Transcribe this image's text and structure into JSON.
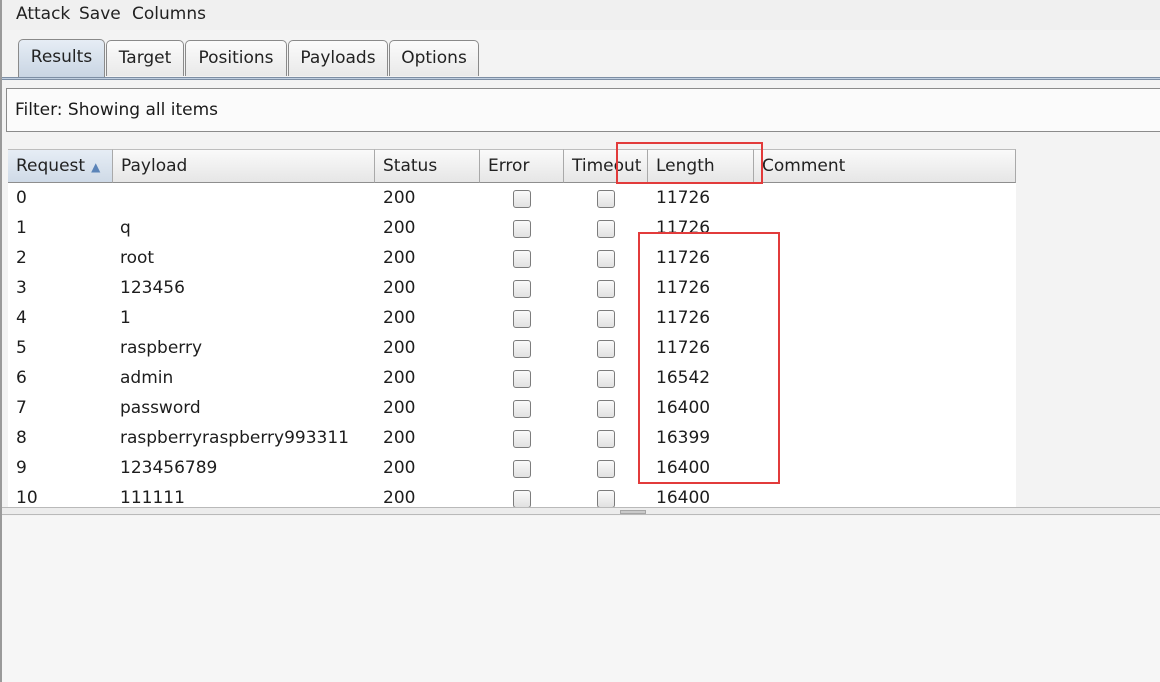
{
  "menu": [
    "Attack",
    "Save",
    "Columns"
  ],
  "tabs": [
    "Results",
    "Target",
    "Positions",
    "Payloads",
    "Options"
  ],
  "active_tab": "Results",
  "filter_text": "Filter: Showing all items",
  "columns": [
    "Request",
    "Payload",
    "Status",
    "Error",
    "Timeout",
    "Length",
    "Comment"
  ],
  "sort_column": "Request",
  "sort_direction": "ascending",
  "rows": [
    {
      "request": "0",
      "payload": "",
      "status": "200",
      "error": false,
      "timeout": false,
      "length": "11726",
      "comment": ""
    },
    {
      "request": "1",
      "payload": "q",
      "status": "200",
      "error": false,
      "timeout": false,
      "length": "11726",
      "comment": ""
    },
    {
      "request": "2",
      "payload": "root",
      "status": "200",
      "error": false,
      "timeout": false,
      "length": "11726",
      "comment": ""
    },
    {
      "request": "3",
      "payload": "123456",
      "status": "200",
      "error": false,
      "timeout": false,
      "length": "11726",
      "comment": ""
    },
    {
      "request": "4",
      "payload": "1",
      "status": "200",
      "error": false,
      "timeout": false,
      "length": "11726",
      "comment": ""
    },
    {
      "request": "5",
      "payload": "raspberry",
      "status": "200",
      "error": false,
      "timeout": false,
      "length": "11726",
      "comment": ""
    },
    {
      "request": "6",
      "payload": "admin",
      "status": "200",
      "error": false,
      "timeout": false,
      "length": "16542",
      "comment": ""
    },
    {
      "request": "7",
      "payload": "password",
      "status": "200",
      "error": false,
      "timeout": false,
      "length": "16400",
      "comment": ""
    },
    {
      "request": "8",
      "payload": "raspberryraspberry993311",
      "status": "200",
      "error": false,
      "timeout": false,
      "length": "16399",
      "comment": ""
    },
    {
      "request": "9",
      "payload": "123456789",
      "status": "200",
      "error": false,
      "timeout": false,
      "length": "16400",
      "comment": ""
    },
    {
      "request": "10",
      "payload": "111111",
      "status": "200",
      "error": false,
      "timeout": false,
      "length": "16400",
      "comment": ""
    }
  ],
  "annotation_color": "#e23b3b"
}
